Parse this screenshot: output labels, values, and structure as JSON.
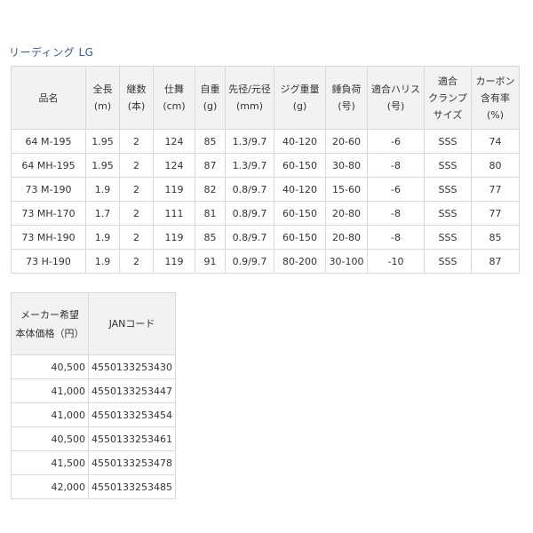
{
  "title": "リーディング LG",
  "spec_table": {
    "headers": [
      [
        "品名"
      ],
      [
        "全長",
        "(m)"
      ],
      [
        "継数",
        "(本)"
      ],
      [
        "仕舞",
        "(cm)"
      ],
      [
        "自重",
        "(g)"
      ],
      [
        "先径/元径",
        "(mm)"
      ],
      [
        "ジグ重量",
        "(g)"
      ],
      [
        "錘負荷",
        "(号)"
      ],
      [
        "適合ハリス",
        "(号)"
      ],
      [
        "適合",
        "クランプ",
        "サイズ"
      ],
      [
        "カーボン",
        "含有率",
        "(%)"
      ]
    ],
    "rows": [
      [
        "64 M-195",
        "1.95",
        "2",
        "124",
        "85",
        "1.3/9.7",
        "40-120",
        "20-60",
        "-6",
        "SSS",
        "74"
      ],
      [
        "64 MH-195",
        "1.95",
        "2",
        "124",
        "87",
        "1.3/9.7",
        "60-150",
        "30-80",
        "-8",
        "SSS",
        "80"
      ],
      [
        "73 M-190",
        "1.9",
        "2",
        "119",
        "82",
        "0.8/9.7",
        "40-120",
        "15-60",
        "-6",
        "SSS",
        "77"
      ],
      [
        "73 MH-170",
        "1.7",
        "2",
        "111",
        "81",
        "0.8/9.7",
        "60-150",
        "20-80",
        "-8",
        "SSS",
        "77"
      ],
      [
        "73 MH-190",
        "1.9",
        "2",
        "119",
        "85",
        "0.8/9.7",
        "60-150",
        "20-80",
        "-8",
        "SSS",
        "85"
      ],
      [
        "73 H-190",
        "1.9",
        "2",
        "119",
        "91",
        "0.9/9.7",
        "80-200",
        "30-100",
        "-10",
        "SSS",
        "87"
      ]
    ]
  },
  "price_table": {
    "headers": [
      [
        "メーカー希望",
        "本体価格（円）"
      ],
      [
        "JANコード"
      ]
    ],
    "rows": [
      [
        "40,500",
        "4550133253430"
      ],
      [
        "41,000",
        "4550133253447"
      ],
      [
        "41,000",
        "4550133253454"
      ],
      [
        "40,500",
        "4550133253461"
      ],
      [
        "41,500",
        "4550133253478"
      ],
      [
        "42,000",
        "4550133253485"
      ]
    ]
  }
}
